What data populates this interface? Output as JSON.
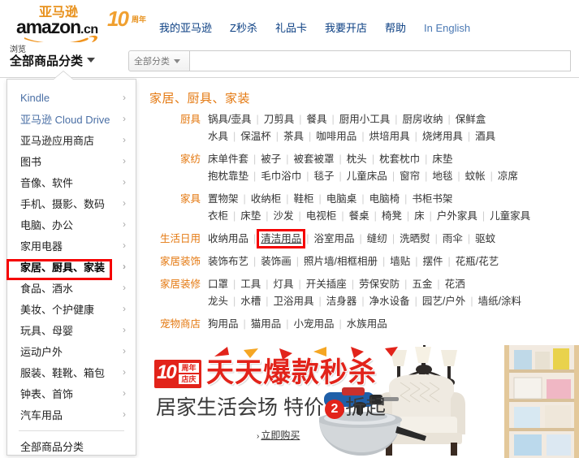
{
  "brand": {
    "logo_cn": "亚马逊",
    "logo_main": "amazon",
    "logo_tld": ".cn",
    "anniversary_number": "10",
    "anniversary_text": "周年",
    "accent_orange": "#E47911",
    "accent_red": "#E2231A",
    "link_blue": "#0A3E82"
  },
  "topnav": {
    "items": [
      {
        "label": "我的亚马逊"
      },
      {
        "label": "Z秒杀"
      },
      {
        "label": "礼品卡"
      },
      {
        "label": "我要开店"
      },
      {
        "label": "帮助"
      },
      {
        "label": "In English"
      }
    ]
  },
  "browse": {
    "small_label": "浏览",
    "big_label": "全部商品分类",
    "caret_icon": "chevron-down-icon"
  },
  "search": {
    "category_label": "全部分类",
    "category_caret_icon": "chevron-down-icon",
    "input_value": "",
    "placeholder": ""
  },
  "sidebar": {
    "items": [
      {
        "label": "Kindle",
        "selected": false
      },
      {
        "label": "亚马逊 Cloud Drive",
        "selected": false
      },
      {
        "label": "亚马逊应用商店",
        "selected": false
      },
      {
        "label": "图书",
        "selected": false
      },
      {
        "label": "音像、软件",
        "selected": false
      },
      {
        "label": "手机、摄影、数码",
        "selected": false
      },
      {
        "label": "电脑、办公",
        "selected": false
      },
      {
        "label": "家用电器",
        "selected": false
      },
      {
        "label": "家居、厨具、家装",
        "selected": true
      },
      {
        "label": "食品、酒水",
        "selected": false
      },
      {
        "label": "美妆、个护健康",
        "selected": false
      },
      {
        "label": "玩具、母婴",
        "selected": false
      },
      {
        "label": "运动户外",
        "selected": false
      },
      {
        "label": "服装、鞋靴、箱包",
        "selected": false
      },
      {
        "label": "钟表、首饰",
        "selected": false
      },
      {
        "label": "汽车用品",
        "selected": false
      }
    ],
    "chevron_icon": "chevron-right-icon",
    "footer_label": "全部商品分类"
  },
  "main": {
    "title": "家居、厨具、家装",
    "groups": [
      {
        "head": "厨具",
        "links": [
          "锅具/壶具",
          "刀剪具",
          "餐具",
          "厨用小工具",
          "厨房收纳",
          "保鲜盒",
          "水具",
          "保温杯",
          "茶具",
          "咖啡用品",
          "烘培用具",
          "烧烤用具",
          "酒具"
        ],
        "break_after": 6
      },
      {
        "head": "家纺",
        "links": [
          "床单件套",
          "被子",
          "被套被罩",
          "枕头",
          "枕套枕巾",
          "床垫",
          "抱枕靠垫",
          "毛巾浴巾",
          "毯子",
          "儿童床品",
          "窗帘",
          "地毯",
          "蚊帐",
          "凉席"
        ],
        "break_after": 6
      },
      {
        "head": "家具",
        "links": [
          "置物架",
          "收纳柜",
          "鞋柜",
          "电脑桌",
          "电脑椅",
          "书柜书架",
          "衣柜",
          "床垫",
          "沙发",
          "电视柜",
          "餐桌",
          "椅凳",
          "床",
          "户外家具",
          "儿童家具"
        ],
        "break_after": 6
      },
      {
        "head": "生活日用",
        "links": [
          "收纳用品",
          "清洁用品",
          "浴室用品",
          "缝纫",
          "洗晒熨",
          "雨伞",
          "驱蚊"
        ],
        "highlight": "清洁用品",
        "break_after": -1
      },
      {
        "head": "家居装饰",
        "links": [
          "装饰布艺",
          "装饰画",
          "照片墙/相框相册",
          "墙贴",
          "摆件",
          "花瓶/花艺"
        ],
        "break_after": -1
      },
      {
        "head": "家居装修",
        "links": [
          "口罩",
          "工具",
          "灯具",
          "开关插座",
          "劳保安防",
          "五金",
          "花洒",
          "龙头",
          "水槽",
          "卫浴用具",
          "洁身器",
          "净水设备",
          "园艺/户外",
          "墙纸/涂料"
        ],
        "break_after": 7
      },
      {
        "head": "宠物商店",
        "links": [
          "狗用品",
          "猫用品",
          "小宠用品",
          "水族用品"
        ],
        "break_after": -1
      }
    ]
  },
  "banner": {
    "badge_number": "10",
    "badge_line1": "周年",
    "badge_line2": "店庆",
    "title": "天天爆款秒杀",
    "subtitle_prefix": "居家生活会场 特价",
    "subtitle_circle": "2",
    "subtitle_suffix": "折起",
    "cta_arrow": "chevron-right-icon",
    "cta_label": "立即购买"
  }
}
